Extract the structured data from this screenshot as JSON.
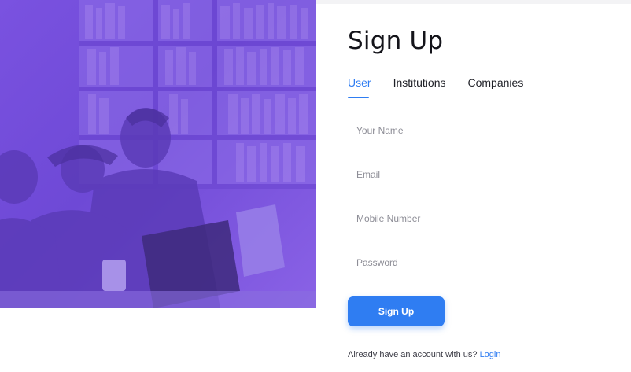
{
  "page": {
    "title": "Sign Up"
  },
  "tabs": [
    {
      "label": "User",
      "active": true
    },
    {
      "label": "Institutions",
      "active": false
    },
    {
      "label": "Companies",
      "active": false
    }
  ],
  "form": {
    "name_placeholder": "Your Name",
    "email_placeholder": "Email",
    "mobile_placeholder": "Mobile Number",
    "password_placeholder": "Password",
    "submit_label": "Sign Up"
  },
  "footer": {
    "prompt": "Already have an account with us?",
    "login_link": "Login"
  },
  "colors": {
    "accent": "#2f7df2",
    "hero_tint": "#7a52e0"
  },
  "hero": {
    "image": "students-with-laptop-in-library-photo"
  }
}
